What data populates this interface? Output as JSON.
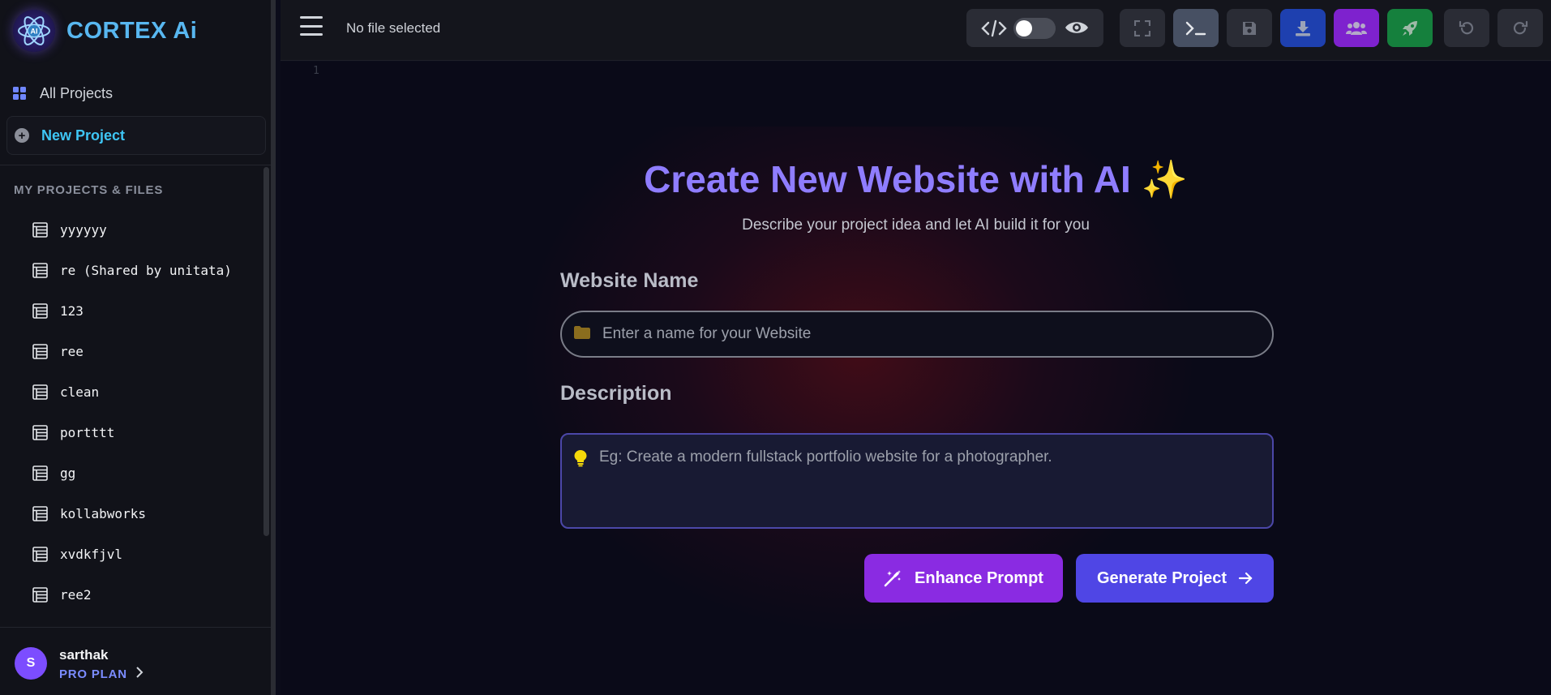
{
  "app": {
    "brand_name": "CORTEX Ai",
    "logo_text": "AI"
  },
  "sidebar": {
    "all_projects_label": "All Projects",
    "new_project_label": "New Project",
    "section_label": "MY PROJECTS & FILES",
    "projects": [
      "yyyyyy",
      "re (Shared by unitata)",
      "123",
      "ree",
      "clean",
      "portttt",
      "gg",
      "kollabworks",
      "xvdkfjvl",
      "ree2"
    ]
  },
  "user": {
    "initial": "S",
    "name": "sarthak",
    "plan": "PRO PLAN"
  },
  "topbar": {
    "file_status": "No file selected",
    "icons": [
      "code-icon",
      "toggle-switch",
      "eye-icon",
      "fullscreen-icon",
      "terminal-icon",
      "save-icon",
      "download-icon",
      "users-icon",
      "rocket-icon",
      "undo-icon",
      "redo-icon"
    ]
  },
  "editor": {
    "line_number": "1"
  },
  "form": {
    "title": "Create New Website with AI ✨",
    "subtitle": "Describe your project idea and let AI build it for you",
    "name_label": "Website Name",
    "name_placeholder": "Enter a name for your Website",
    "description_label": "Description",
    "description_placeholder": "Eg: Create a modern fullstack portfolio website for a photographer.",
    "enhance_label": "Enhance Prompt",
    "generate_label": "Generate Project"
  },
  "colors": {
    "brand": "#58b7f0",
    "title": "#8f7dff",
    "enhance_button": "#8a2be2",
    "generate_button": "#4f46e5",
    "download_button": "#1e40af",
    "users_button": "#7e22ce",
    "deploy_button": "#15803d"
  }
}
